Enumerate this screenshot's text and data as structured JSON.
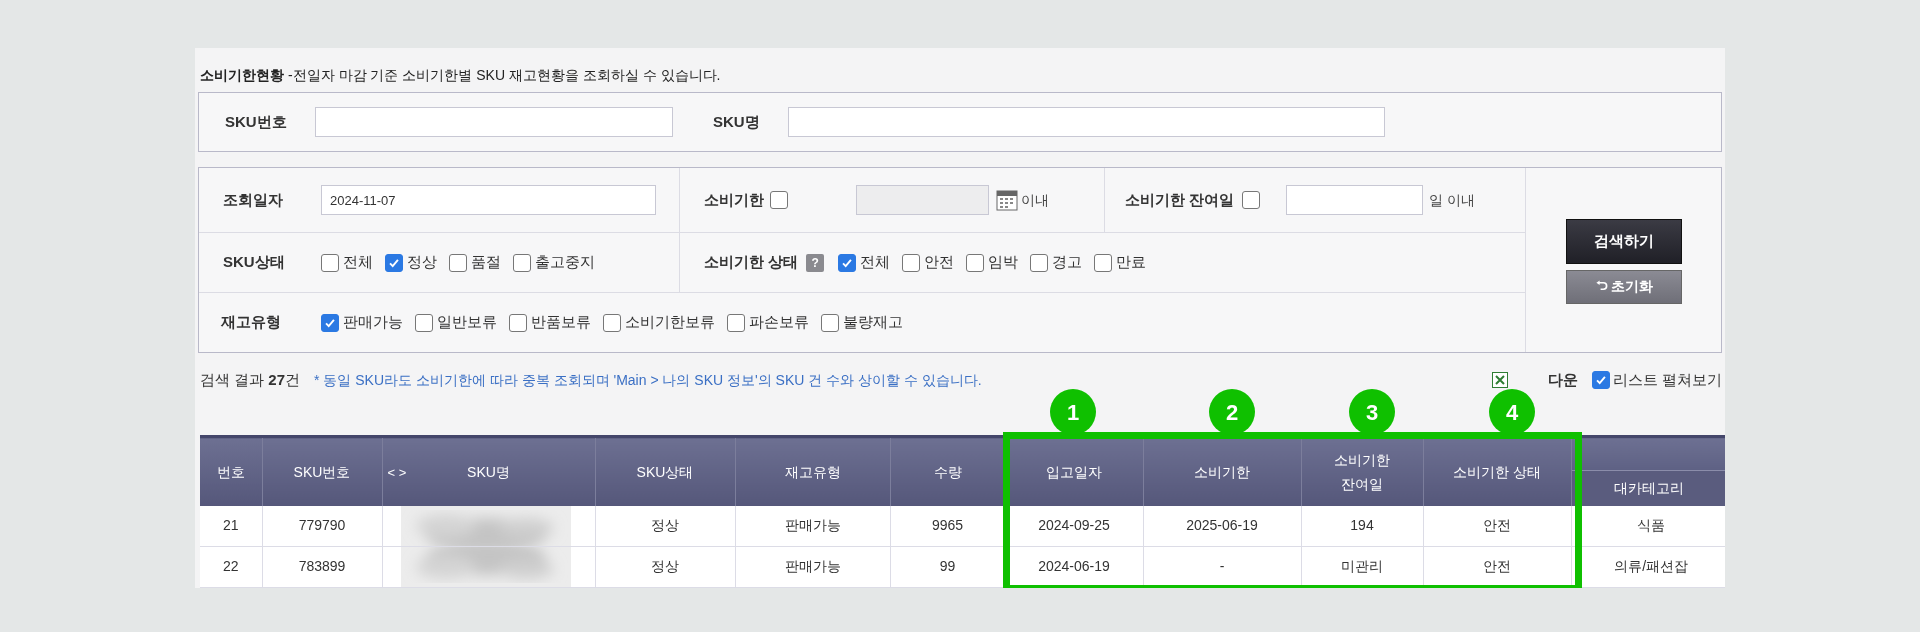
{
  "header": {
    "title": "소비기한현황",
    "description": "-전일자 마감 기준 소비기한별  SKU 재고현황을 조회하실 수 있습니다."
  },
  "search_fields": [
    {
      "label": "SKU번호"
    },
    {
      "label": "SKU명"
    }
  ],
  "filters": {
    "inquiry_date": {
      "label": "조회일자",
      "value": "2024-11-07"
    },
    "expiry": {
      "label": "소비기한",
      "checked": false,
      "suffix": "이내"
    },
    "remaining_days": {
      "label": "소비기한 잔여일",
      "checked": false,
      "suffix": "일 이내"
    },
    "sku_status": {
      "label": "SKU상태",
      "options": [
        {
          "label": "전체",
          "checked": false
        },
        {
          "label": "정상",
          "checked": true
        },
        {
          "label": "품절",
          "checked": false
        },
        {
          "label": "출고중지",
          "checked": false
        }
      ]
    },
    "expiry_status": {
      "label": "소비기한 상태",
      "help": "?",
      "options": [
        {
          "label": "전체",
          "checked": true
        },
        {
          "label": "안전",
          "checked": false
        },
        {
          "label": "임박",
          "checked": false
        },
        {
          "label": "경고",
          "checked": false
        },
        {
          "label": "만료",
          "checked": false
        }
      ]
    },
    "stock_type": {
      "label": "재고유형",
      "options": [
        {
          "label": "판매가능",
          "checked": true
        },
        {
          "label": "일반보류",
          "checked": false
        },
        {
          "label": "반품보류",
          "checked": false
        },
        {
          "label": "소비기한보류",
          "checked": false
        },
        {
          "label": "파손보류",
          "checked": false
        },
        {
          "label": "불량재고",
          "checked": false
        }
      ]
    }
  },
  "buttons": [
    {
      "label": "검색하기",
      "kind": "primary"
    },
    {
      "label": "초기화",
      "kind": "reset"
    }
  ],
  "results": {
    "summary": "검색 결과 **27**건",
    "note": "* 동일 SKU라도 소비기한에 따라 중복 조회되며 'Main > 나의 SKU 정보'의 SKU 건 수와 상이할 수 있습니다.",
    "excel": "다운",
    "expand": {
      "label": "리스트 펼쳐보기",
      "checked": true
    }
  },
  "table": {
    "columns": [
      {
        "label": "번호"
      },
      {
        "label": "SKU번호"
      },
      {
        "label": "SKU명",
        "arrows": "< >"
      },
      {
        "label": "SKU상태"
      },
      {
        "label": "재고유형"
      },
      {
        "label": "수량"
      },
      {
        "label": "입고일자"
      },
      {
        "label": "소비기한"
      },
      {
        "label": "소비기한 잔여일"
      },
      {
        "label": "소비기한 상태"
      },
      {
        "label": "대카테고리"
      }
    ],
    "rows": [
      {
        "cells": [
          "21",
          "779790",
          {
            "kind": "picture"
          },
          "정상",
          "판매가능",
          "9965",
          "2024-09-25",
          "2025-06-19",
          "194",
          "안전",
          "식품"
        ]
      },
      {
        "cells": [
          "22",
          "783899",
          {
            "kind": "picture"
          },
          "정상",
          "판매가능",
          "99",
          "2024-06-19",
          "-",
          "미관리",
          "안전",
          "의류/패션잡"
        ]
      }
    ]
  },
  "annotations": {
    "labels": [
      "1",
      "2",
      "3",
      "4"
    ]
  }
}
